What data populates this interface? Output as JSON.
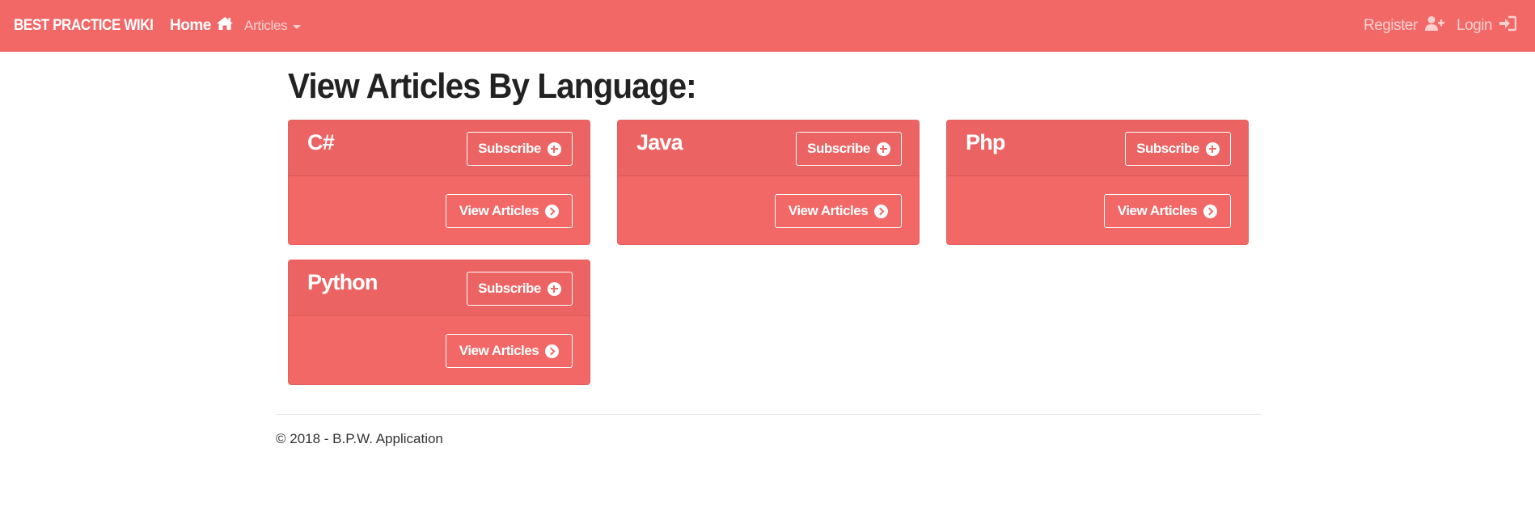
{
  "navbar": {
    "brand": "BEST PRACTICE WIKI",
    "home_label": "Home",
    "articles_label": "Articles",
    "register_label": "Register",
    "login_label": "Login"
  },
  "page": {
    "title": "View Articles By Language:"
  },
  "languages": [
    {
      "name": "C#",
      "subscribe_label": "Subscribe",
      "view_label": "View Articles"
    },
    {
      "name": "Java",
      "subscribe_label": "Subscribe",
      "view_label": "View Articles"
    },
    {
      "name": "Php",
      "subscribe_label": "Subscribe",
      "view_label": "View Articles"
    },
    {
      "name": "Python",
      "subscribe_label": "Subscribe",
      "view_label": "View Articles"
    }
  ],
  "footer": {
    "text": "© 2018 - B.P.W. Application"
  },
  "colors": {
    "accent": "#f26867",
    "text": "#222222"
  },
  "icons": {
    "home": "home-icon",
    "articles_dropdown": "caret-down-icon",
    "register": "user-plus-icon",
    "login": "sign-in-icon",
    "subscribe": "plus-circle-icon",
    "view": "chevron-circle-right-icon"
  }
}
